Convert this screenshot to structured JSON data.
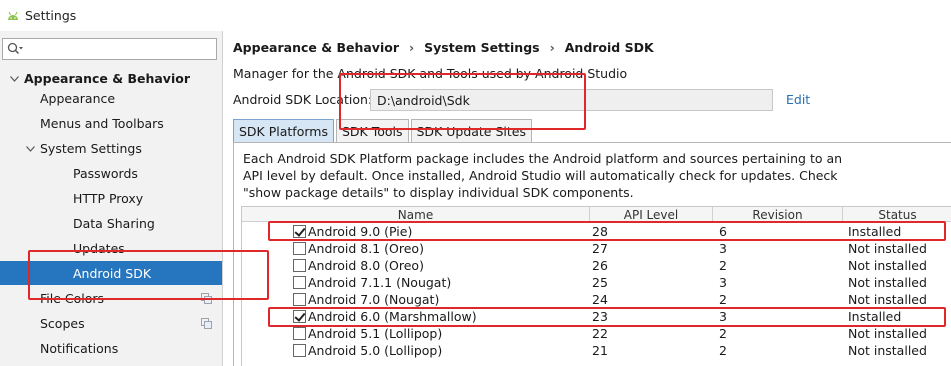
{
  "window": {
    "title": "Settings"
  },
  "search": {
    "placeholder": ""
  },
  "sidebar": {
    "items": [
      {
        "label": "Appearance & Behavior",
        "level": 0,
        "expanded": true,
        "bold": true
      },
      {
        "label": "Appearance",
        "level": 1
      },
      {
        "label": "Menus and Toolbars",
        "level": 1
      },
      {
        "label": "System Settings",
        "level": 1,
        "expanded": true
      },
      {
        "label": "Passwords",
        "level": 2
      },
      {
        "label": "HTTP Proxy",
        "level": 2
      },
      {
        "label": "Data Sharing",
        "level": 2
      },
      {
        "label": "Updates",
        "level": 2
      },
      {
        "label": "Android SDK",
        "level": 2,
        "selected": true
      },
      {
        "label": "File Colors",
        "level": 1
      },
      {
        "label": "Scopes",
        "level": 1
      },
      {
        "label": "Notifications",
        "level": 1
      }
    ]
  },
  "breadcrumb": [
    "Appearance & Behavior",
    "System Settings",
    "Android SDK"
  ],
  "description": "Manager for the Android SDK and Tools used by Android Studio",
  "sdk_location": {
    "label": "Android SDK Location:",
    "value": "D:\\android\\Sdk",
    "edit_label": "Edit"
  },
  "tabs": [
    "SDK Platforms",
    "SDK Tools",
    "SDK Update Sites"
  ],
  "panel_description": "Each Android SDK Platform package includes the Android platform and sources pertaining to an API level by default. Once installed, Android Studio will automatically check for updates. Check \"show package details\" to display individual SDK components.",
  "table": {
    "columns": [
      "Name",
      "API Level",
      "Revision",
      "Status"
    ],
    "rows": [
      {
        "name": "Android 9.0 (Pie)",
        "api": "28",
        "revision": "6",
        "status": "Installed",
        "checked": true
      },
      {
        "name": "Android 8.1 (Oreo)",
        "api": "27",
        "revision": "3",
        "status": "Not installed",
        "checked": false
      },
      {
        "name": "Android 8.0 (Oreo)",
        "api": "26",
        "revision": "2",
        "status": "Not installed",
        "checked": false
      },
      {
        "name": "Android 7.1.1 (Nougat)",
        "api": "25",
        "revision": "3",
        "status": "Not installed",
        "checked": false
      },
      {
        "name": "Android 7.0 (Nougat)",
        "api": "24",
        "revision": "2",
        "status": "Not installed",
        "checked": false
      },
      {
        "name": "Android 6.0 (Marshmallow)",
        "api": "23",
        "revision": "3",
        "status": "Installed",
        "checked": true
      },
      {
        "name": "Android 5.1 (Lollipop)",
        "api": "22",
        "revision": "2",
        "status": "Not installed",
        "checked": false
      },
      {
        "name": "Android 5.0 (Lollipop)",
        "api": "21",
        "revision": "2",
        "status": "Not installed",
        "checked": false
      }
    ]
  },
  "colors": {
    "selection": "#2675bf",
    "link": "#2470b3",
    "highlight": "#e0272a",
    "sidebar_bg": "#f2f2f2"
  }
}
